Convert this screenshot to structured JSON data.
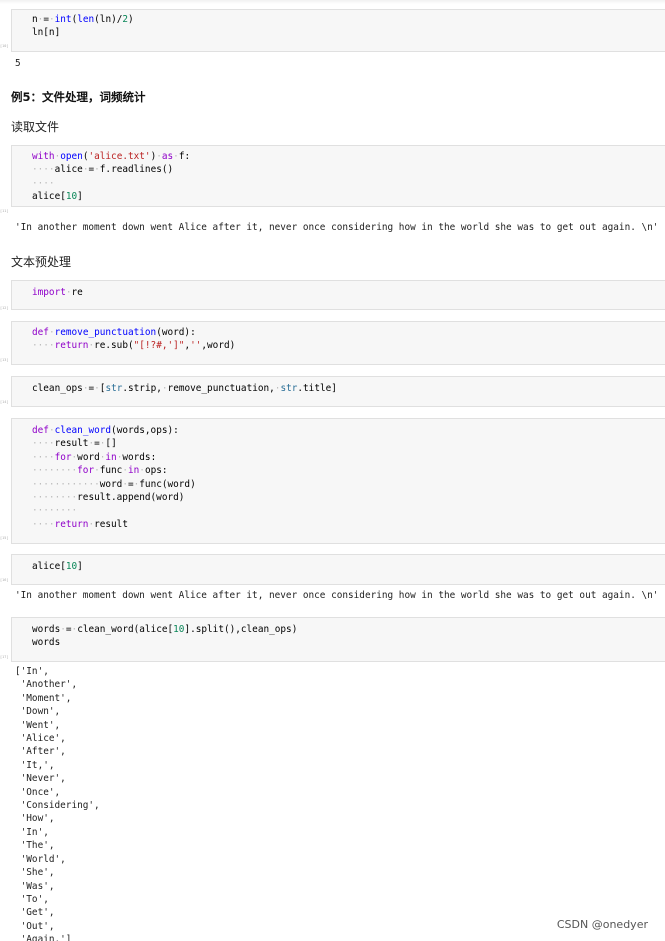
{
  "cells": [
    {
      "id": "c1",
      "lines": [
        "n = int(len(ln)/2)",
        "ln[n]"
      ]
    },
    {
      "id": "c2",
      "lines": [
        "with open('alice.txt') as f:",
        "    alice = f.readlines()",
        "    ",
        "alice[10]"
      ]
    },
    {
      "id": "c3",
      "lines": [
        "import re"
      ]
    },
    {
      "id": "c4",
      "lines": [
        "def remove_punctuation(word):",
        "    return re.sub(\"[!?#,']\",'',word)"
      ]
    },
    {
      "id": "c5",
      "lines": [
        "clean_ops = [str.strip, remove_punctuation, str.title]"
      ]
    },
    {
      "id": "c6",
      "lines": [
        "def clean_word(words,ops):",
        "    result = []",
        "    for word in words:",
        "        for func in ops:",
        "            word = func(word)",
        "        result.append(word)",
        "    ",
        "    return result"
      ]
    },
    {
      "id": "c7",
      "lines": [
        "alice[10]"
      ]
    },
    {
      "id": "c8",
      "lines": [
        "words = clean_word(alice[10].split(),clean_ops)",
        "words"
      ]
    }
  ],
  "outputs": {
    "o1": "5",
    "o2": "'In another moment down went Alice after it, never once considering how in the world she was to get out again. \\n'",
    "o3": "'In another moment down went Alice after it, never once considering how in the world she was to get out again. \\n'",
    "o4": [
      "['In',",
      " 'Another',",
      " 'Moment',",
      " 'Down',",
      " 'Went',",
      " 'Alice',",
      " 'After',",
      " 'It,',",
      " 'Never',",
      " 'Once',",
      " 'Considering',",
      " 'How',",
      " 'In',",
      " 'The',",
      " 'World',",
      " 'She',",
      " 'Was',",
      " 'To',",
      " 'Get',",
      " 'Out',",
      " 'Again.']"
    ]
  },
  "headings": {
    "example5": "例5：文件处理，词频统计",
    "read_file": "读取文件",
    "preprocess": "文本预处理"
  },
  "prompts": {
    "p1": "[10]",
    "p2": "[11]",
    "p3": "[12]",
    "p4": "[13]",
    "p5": "[14]",
    "p6": "[15]",
    "p7": "[16]",
    "p8": "[17]"
  },
  "watermark": "CSDN @onedyer"
}
